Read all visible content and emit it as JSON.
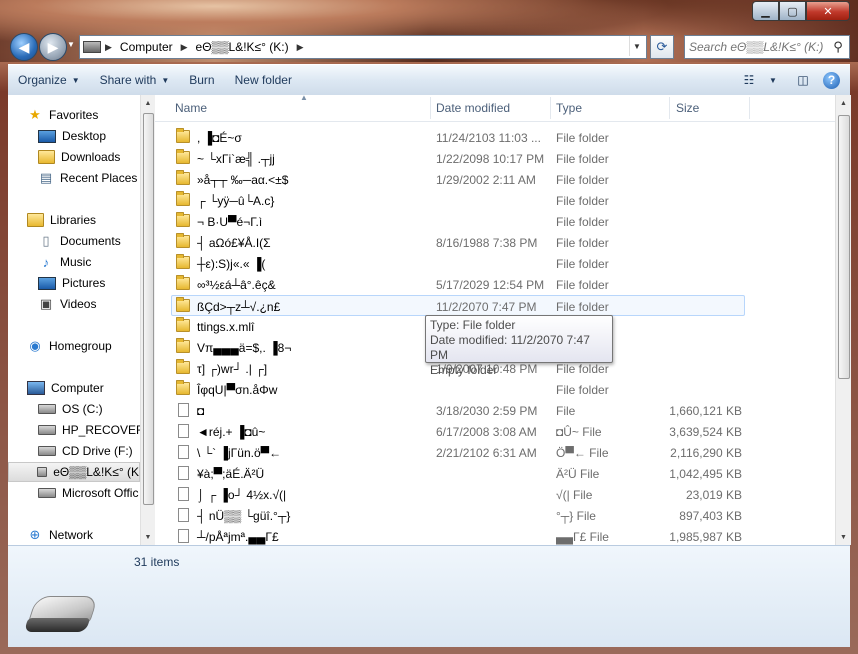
{
  "address": {
    "crumbs": [
      "Computer",
      "eΘ▒▒L&!K≤° (K:)"
    ]
  },
  "search": {
    "placeholder": "Search eΘ▒▒L&!K≤° (K:)"
  },
  "toolbar": {
    "organize": "Organize",
    "share_with": "Share with",
    "burn": "Burn",
    "new_folder": "New folder"
  },
  "nav": {
    "favorites": "Favorites",
    "desktop": "Desktop",
    "downloads": "Downloads",
    "recent": "Recent Places",
    "libraries": "Libraries",
    "documents": "Documents",
    "music": "Music",
    "pictures": "Pictures",
    "videos": "Videos",
    "homegroup": "Homegroup",
    "computer": "Computer",
    "os": "OS (C:)",
    "hp": "HP_RECOVERY",
    "cd": "CD Drive (F:)",
    "k": "eΘ▒▒L&!K≤° (K",
    "office": "Microsoft Offic",
    "network": "Network"
  },
  "columns": {
    "name": "Name",
    "date": "Date modified",
    "type": "Type",
    "size": "Size"
  },
  "files": [
    {
      "name": ", ▐◘É~σ",
      "date": "11/24/2103 11:03 ...",
      "type": "File folder",
      "size": "",
      "kind": "folder"
    },
    {
      "name": "~ └xΓi`æ╣ .┬jj",
      "date": "1/22/2098 10:17 PM",
      "type": "File folder",
      "size": "",
      "kind": "folder"
    },
    {
      "name": "»å┬┬ ‰─aα.<±$",
      "date": "1/29/2002 2:11 AM",
      "type": "File folder",
      "size": "",
      "kind": "folder"
    },
    {
      "name": "┌ └yÿ─û└A.c}",
      "date": "",
      "type": "File folder",
      "size": "",
      "kind": "folder"
    },
    {
      "name": "¬ B·U▀é¬Γ.ì",
      "date": "",
      "type": "File folder",
      "size": "",
      "kind": "folder"
    },
    {
      "name": "┤ aΩó£¥Å.I(Σ",
      "date": "8/16/1988 7:38 PM",
      "type": "File folder",
      "size": "",
      "kind": "folder"
    },
    {
      "name": "┼ε):S)j«.« ▐(",
      "date": "",
      "type": "File folder",
      "size": "",
      "kind": "folder"
    },
    {
      "name": "∞³½εá┴â°.êç&",
      "date": "5/17/2029 12:54 PM",
      "type": "File folder",
      "size": "",
      "kind": "folder"
    },
    {
      "name": "ßÇd>┬z┴√.¿n£",
      "date": "11/2/2070 7:47 PM",
      "type": "File folder",
      "size": "",
      "kind": "folder",
      "hover": true
    },
    {
      "name": "ttings.x.mlî",
      "date": "",
      "type": "File folder",
      "size": "",
      "kind": "folder"
    },
    {
      "name": "Vπ▄▄▄ä=$,. ▐8¬",
      "date": "",
      "type": "File folder",
      "size": "",
      "kind": "folder"
    },
    {
      "name": "τ] ┌)wr┘ .| ┌]",
      "date": "1/9/2007 10:48 PM",
      "type": "File folder",
      "size": "",
      "kind": "folder"
    },
    {
      "name": "ÎφqU|▀σn.åΦw",
      "date": "",
      "type": "File folder",
      "size": "",
      "kind": "folder"
    },
    {
      "name": "◘",
      "date": "3/18/2030 2:59 PM",
      "type": "File",
      "size": "1,660,121 KB",
      "kind": "file"
    },
    {
      "name": "◄réj.+ ▐◘û~",
      "date": "6/17/2008 3:08 AM",
      "type": "◘Û~ File",
      "size": "3,639,524 KB",
      "kind": "file"
    },
    {
      "name": "\\ └` ▐jΓün.ö▀←",
      "date": "2/21/2102 6:31 AM",
      "type": "Ö▀← File",
      "size": "2,116,290 KB",
      "kind": "file"
    },
    {
      "name": "¥à;▀;äÉ.Ä²Ü",
      "date": "",
      "type": "Ä²Ü File",
      "size": "1,042,495 KB",
      "kind": "file"
    },
    {
      "name": "⌡ ┌ ▐o┘ 4½x.√(|",
      "date": "",
      "type": "√(| File",
      "size": "23,019 KB",
      "kind": "file"
    },
    {
      "name": "┤ nÜ▒▒ └güî.°┬}",
      "date": "",
      "type": "°┬} File",
      "size": "897,403 KB",
      "kind": "file"
    },
    {
      "name": "┴/pÅªjmª.▄▄Γ£",
      "date": "",
      "type": "▄▄Γ£ File",
      "size": "1,985,987 KB",
      "kind": "file"
    }
  ],
  "tooltip": {
    "line1": "Type: File folder",
    "line2": "Date modified: 11/2/2070 7:47 PM",
    "line3": "Empty folder"
  },
  "status": {
    "count": "31 items"
  }
}
